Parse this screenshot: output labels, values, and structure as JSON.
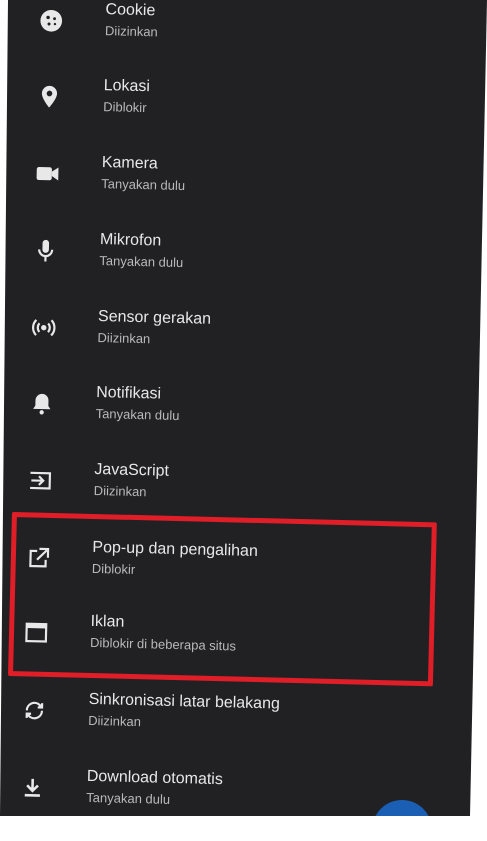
{
  "settings": {
    "items": [
      {
        "title": "Cookie",
        "status": "Diizinkan",
        "icon": "cookie-icon"
      },
      {
        "title": "Lokasi",
        "status": "Diblokir",
        "icon": "location-pin-icon"
      },
      {
        "title": "Kamera",
        "status": "Tanyakan dulu",
        "icon": "camera-icon"
      },
      {
        "title": "Mikrofon",
        "status": "Tanyakan dulu",
        "icon": "microphone-icon"
      },
      {
        "title": "Sensor gerakan",
        "status": "Diizinkan",
        "icon": "motion-sensor-icon"
      },
      {
        "title": "Notifikasi",
        "status": "Tanyakan dulu",
        "icon": "bell-icon"
      },
      {
        "title": "JavaScript",
        "status": "Diizinkan",
        "icon": "javascript-icon"
      },
      {
        "title": "Pop-up dan pengalihan",
        "status": "Diblokir",
        "icon": "popup-icon"
      },
      {
        "title": "Iklan",
        "status": "Diblokir di beberapa situs",
        "icon": "ads-window-icon"
      },
      {
        "title": "Sinkronisasi latar belakang",
        "status": "Diizinkan",
        "icon": "sync-icon"
      },
      {
        "title": "Download otomatis",
        "status": "Tanyakan dulu",
        "icon": "download-icon"
      }
    ]
  },
  "colors": {
    "background": "#212124",
    "highlight_border": "#e01e28",
    "text_primary": "#e8e8e8",
    "text_secondary": "#b9b9b9"
  }
}
